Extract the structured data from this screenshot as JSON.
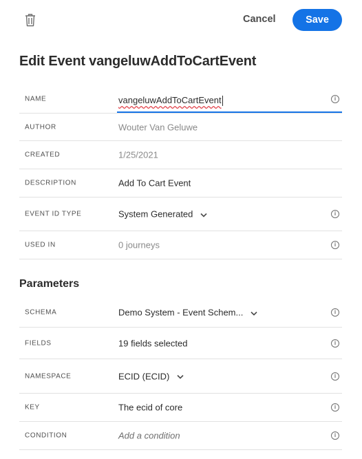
{
  "toolbar": {
    "cancel_label": "Cancel",
    "save_label": "Save"
  },
  "title": "Edit Event vangeluwAddToCartEvent",
  "event_fields": [
    {
      "label": "NAME",
      "value": "vangeluwAddToCartEvent"
    },
    {
      "label": "AUTHOR",
      "value": "Wouter Van Geluwe"
    },
    {
      "label": "CREATED",
      "value": "1/25/2021"
    },
    {
      "label": "DESCRIPTION",
      "value": "Add To Cart Event"
    },
    {
      "label": "EVENT ID TYPE",
      "value": "System Generated"
    },
    {
      "label": "USED IN",
      "value": "0 journeys"
    }
  ],
  "parameters": {
    "heading": "Parameters",
    "fields": [
      {
        "label": "SCHEMA",
        "value": "Demo System - Event Schem..."
      },
      {
        "label": "FIELDS",
        "value": "19 fields selected"
      },
      {
        "label": "NAMESPACE",
        "value": "ECID (ECID)"
      },
      {
        "label": "KEY",
        "value": "The ecid of core"
      },
      {
        "label": "CONDITION",
        "placeholder": "Add a condition"
      }
    ]
  },
  "icons": {
    "delete": "trash-icon",
    "info": "info-icon",
    "dropdown": "chevron-down-icon"
  },
  "colors": {
    "accent": "#1473e6",
    "spellcheck": "#e34850"
  }
}
